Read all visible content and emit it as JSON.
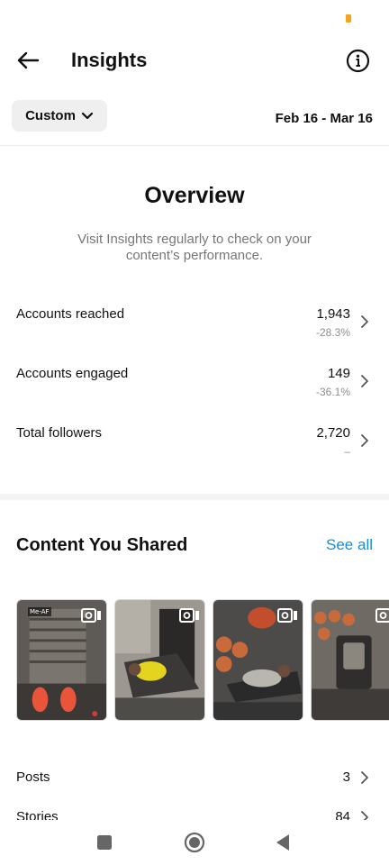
{
  "header": {
    "title": "Insights"
  },
  "filter": {
    "selected": "Custom",
    "date_range": "Feb 16 - Mar 16"
  },
  "overview": {
    "title": "Overview",
    "subtitle": "Visit Insights regularly to check on your content’s performance.",
    "metrics": [
      {
        "label": "Accounts reached",
        "value": "1,943",
        "change": "-28.3%"
      },
      {
        "label": "Accounts engaged",
        "value": "149",
        "change": "-36.1%"
      },
      {
        "label": "Total followers",
        "value": "2,720",
        "change": "–"
      }
    ]
  },
  "content": {
    "title": "Content You Shared",
    "see_all": "See all",
    "thumbnails": [
      {
        "label": "Me-AF",
        "type": "video",
        "colors": [
          "#6b6660",
          "#3a3836"
        ]
      },
      {
        "label": "",
        "type": "video",
        "colors": [
          "#8a8780",
          "#2e2d2b"
        ]
      },
      {
        "label": "",
        "type": "video",
        "colors": [
          "#5a5857",
          "#2a2a2a"
        ]
      },
      {
        "label": "",
        "type": "video",
        "colors": [
          "#7a746c",
          "#3b3937"
        ]
      }
    ],
    "rows": [
      {
        "label": "Posts",
        "value": "3"
      },
      {
        "label": "Stories",
        "value": "84"
      }
    ]
  },
  "colors": {
    "accent": "#1a8cd8",
    "status_indicator": "#f2a320"
  },
  "icons": {
    "back": "arrow-left-icon",
    "info": "info-circle-icon",
    "dropdown": "chevron-down-icon",
    "row": "chevron-right-icon",
    "video": "video-camera-icon",
    "nav": [
      "square-recents-icon",
      "circle-home-icon",
      "triangle-back-icon"
    ]
  }
}
